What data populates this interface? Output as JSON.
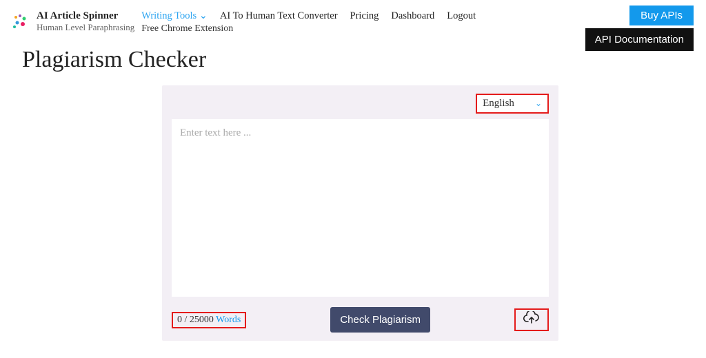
{
  "brand": {
    "title": "AI Article Spinner",
    "subtitle": "Human Level Paraphrasing"
  },
  "nav": {
    "items": [
      {
        "label": "Writing Tools",
        "active": true,
        "has_dropdown": true
      },
      {
        "label": "AI To Human Text Converter"
      },
      {
        "label": "Pricing"
      },
      {
        "label": "Dashboard"
      },
      {
        "label": "Logout"
      }
    ],
    "secondary": "Free Chrome Extension"
  },
  "cta": {
    "buy_apis": "Buy APIs",
    "api_docs": "API Documentation"
  },
  "page": {
    "title": "Plagiarism Checker"
  },
  "tool": {
    "language": "English",
    "placeholder": "Enter text here ...",
    "word_count": "0 / 25000",
    "word_label": "Words",
    "check_button": "Check Plagiarism"
  }
}
